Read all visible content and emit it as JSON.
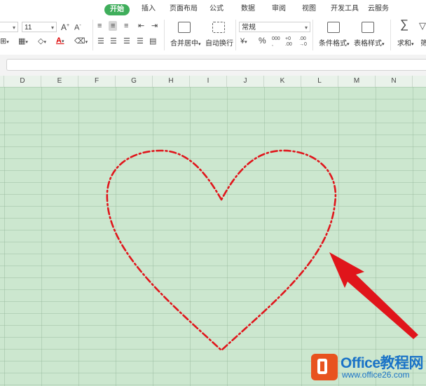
{
  "menu": {
    "tabs": [
      {
        "label": "开始",
        "active": true
      },
      {
        "label": "插入",
        "active": false
      },
      {
        "label": "页面布局",
        "active": false
      },
      {
        "label": "公式",
        "active": false
      },
      {
        "label": "数据",
        "active": false
      },
      {
        "label": "审阅",
        "active": false
      },
      {
        "label": "视图",
        "active": false
      },
      {
        "label": "开发工具",
        "active": false
      },
      {
        "label": "云服务",
        "active": false
      }
    ],
    "active_color": "#3fae5b"
  },
  "ribbon": {
    "font_size": "11",
    "merge_center_label": "合并居中",
    "wrap_text_label": "自动换行",
    "number_format": "常规",
    "conditional_format_label": "条件格式",
    "table_style_label": "表格样式",
    "sum_label": "求和",
    "filter_label_partial": "筛"
  },
  "columns": [
    "D",
    "E",
    "F",
    "G",
    "H",
    "I",
    "J",
    "K",
    "L",
    "M",
    "N"
  ],
  "sheet": {
    "grid_color": "#cce7cf",
    "shape": "heart",
    "shape_outline": "dash-dot",
    "shape_color": "#e0151b",
    "arrow_color": "#e0151b"
  },
  "watermark": {
    "title": "Office教程网",
    "url": "www.office26.com",
    "logo_color": "#e8531f",
    "text_color": "#1a73c7"
  }
}
